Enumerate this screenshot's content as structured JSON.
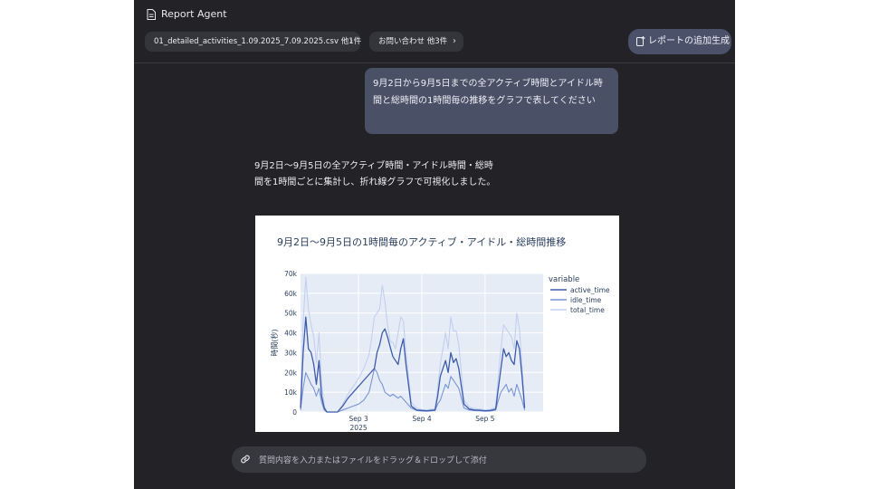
{
  "app": {
    "title": "Report Agent"
  },
  "toolbar": {
    "file_chip": "01_detailed_activities_1.09.2025_7.09.2025.csv 他1件",
    "inquiry_chip": "お問い合わせ 他3件",
    "add_report_label": "レポートの追加生成"
  },
  "conversation": {
    "user_message": "9月2日から9月5日までの全アクティブ時間とアイドル時間と総時間の1時間毎の推移をグラフで表してください",
    "assistant_message": "9月2日〜9月5日の全アクティブ時間・アイドル時間・総時間を1時間ごとに集計し、折れ線グラフで可視化しました。"
  },
  "composer": {
    "placeholder": "質問内容を入力またはファイルをドラッグ＆ドロップして添付"
  },
  "colors": {
    "active": "#3d5bab",
    "idle": "#7a95d6",
    "total": "#c3cff0",
    "plot_bg": "#e5ecf6",
    "accent_button": "#4b5169"
  },
  "chart_data": {
    "type": "line",
    "title": "9月2日〜9月5日の1時間毎のアクティブ・アイドル・総時間推移",
    "xlabel": "",
    "ylabel": "時間(秒)",
    "ylim": [
      0,
      70000
    ],
    "yticks": [
      "0",
      "10k",
      "20k",
      "30k",
      "40k",
      "50k",
      "60k",
      "70k"
    ],
    "yticks_values": [
      0,
      10000,
      20000,
      30000,
      40000,
      50000,
      60000,
      70000
    ],
    "xlim": [
      0,
      92
    ],
    "xticks": [
      {
        "label": "Sep 3",
        "sub": "2025",
        "x": 22
      },
      {
        "label": "Sep 4",
        "sub": "",
        "x": 46
      },
      {
        "label": "Sep 5",
        "sub": "",
        "x": 70
      }
    ],
    "legend": {
      "title": "variable",
      "placement": "right"
    },
    "grid": true,
    "series": [
      {
        "name": "active_time",
        "x": [
          0,
          1,
          2,
          3,
          4,
          5,
          6,
          7,
          8,
          9,
          10,
          11,
          14,
          16,
          18,
          20,
          22,
          24,
          26,
          28,
          29,
          30,
          31,
          32,
          33,
          34,
          35,
          36,
          37,
          38,
          39,
          40,
          42,
          44,
          46,
          48,
          50,
          51,
          52,
          53,
          54,
          55,
          56,
          57,
          58,
          59,
          60,
          62,
          64,
          66,
          68,
          70,
          72,
          74,
          75,
          76,
          77,
          78,
          79,
          80,
          81,
          82,
          83,
          84,
          85
        ],
        "values": [
          2000,
          30000,
          48000,
          32000,
          30000,
          24000,
          14000,
          26000,
          8000,
          2000,
          0,
          0,
          0,
          3000,
          7000,
          10000,
          13000,
          16000,
          19000,
          22000,
          30000,
          34000,
          40000,
          42000,
          38000,
          33000,
          28000,
          26000,
          24000,
          32000,
          37000,
          24000,
          3000,
          1000,
          800,
          600,
          900,
          1000,
          8000,
          18000,
          22000,
          26000,
          20000,
          30000,
          25000,
          27000,
          22000,
          4000,
          1500,
          1000,
          900,
          600,
          800,
          1500,
          12000,
          22000,
          32000,
          28000,
          30000,
          26000,
          24000,
          36000,
          32000,
          18000,
          2000
        ]
      },
      {
        "name": "idle_time",
        "x": [
          0,
          1,
          2,
          3,
          4,
          5,
          6,
          7,
          8,
          9,
          10,
          11,
          14,
          16,
          18,
          20,
          22,
          24,
          26,
          27,
          28,
          29,
          30,
          31,
          32,
          33,
          34,
          35,
          36,
          37,
          38,
          40,
          42,
          44,
          46,
          48,
          50,
          51,
          52,
          53,
          54,
          55,
          56,
          57,
          58,
          59,
          60,
          62,
          64,
          66,
          68,
          70,
          72,
          74,
          75,
          76,
          77,
          78,
          79,
          80,
          81,
          82,
          83,
          84,
          85
        ],
        "values": [
          1000,
          12000,
          20000,
          17000,
          14000,
          12000,
          8000,
          12000,
          5000,
          1000,
          0,
          0,
          0,
          1000,
          2000,
          3000,
          4000,
          6000,
          10000,
          16000,
          22000,
          20000,
          16000,
          14000,
          10000,
          9000,
          8000,
          9000,
          8000,
          7000,
          8000,
          5000,
          2000,
          800,
          500,
          400,
          600,
          800,
          4000,
          6000,
          10000,
          14000,
          12000,
          18000,
          16000,
          14000,
          12000,
          2000,
          1000,
          700,
          600,
          400,
          500,
          1000,
          6000,
          10000,
          12000,
          14000,
          10000,
          12000,
          8000,
          14000,
          10000,
          6000,
          1000
        ]
      },
      {
        "name": "total_time",
        "x": [
          0,
          1,
          2,
          3,
          4,
          5,
          6,
          7,
          8,
          9,
          10,
          11,
          14,
          16,
          18,
          20,
          22,
          24,
          26,
          27,
          28,
          29,
          30,
          31,
          32,
          33,
          34,
          35,
          36,
          37,
          38,
          39,
          40,
          42,
          44,
          46,
          48,
          50,
          51,
          52,
          53,
          54,
          55,
          56,
          57,
          58,
          59,
          60,
          62,
          64,
          66,
          68,
          70,
          72,
          74,
          75,
          76,
          77,
          78,
          79,
          80,
          81,
          82,
          83,
          84,
          85
        ],
        "values": [
          5000,
          45000,
          68000,
          52000,
          44000,
          38000,
          25000,
          40000,
          15000,
          3000,
          0,
          0,
          0,
          4000,
          9000,
          13000,
          17000,
          22000,
          29000,
          38000,
          48000,
          50000,
          52000,
          64000,
          56000,
          44000,
          36000,
          35000,
          32000,
          40000,
          48000,
          46000,
          30000,
          5000,
          2000,
          1200,
          1000,
          1500,
          1800,
          12000,
          24000,
          32000,
          40000,
          32000,
          48000,
          41000,
          41000,
          34000,
          6000,
          2500,
          1700,
          1500,
          1000,
          1300,
          2500,
          18000,
          32000,
          44000,
          42000,
          40000,
          38000,
          32000,
          50000,
          42000,
          24000,
          3000
        ]
      }
    ]
  }
}
